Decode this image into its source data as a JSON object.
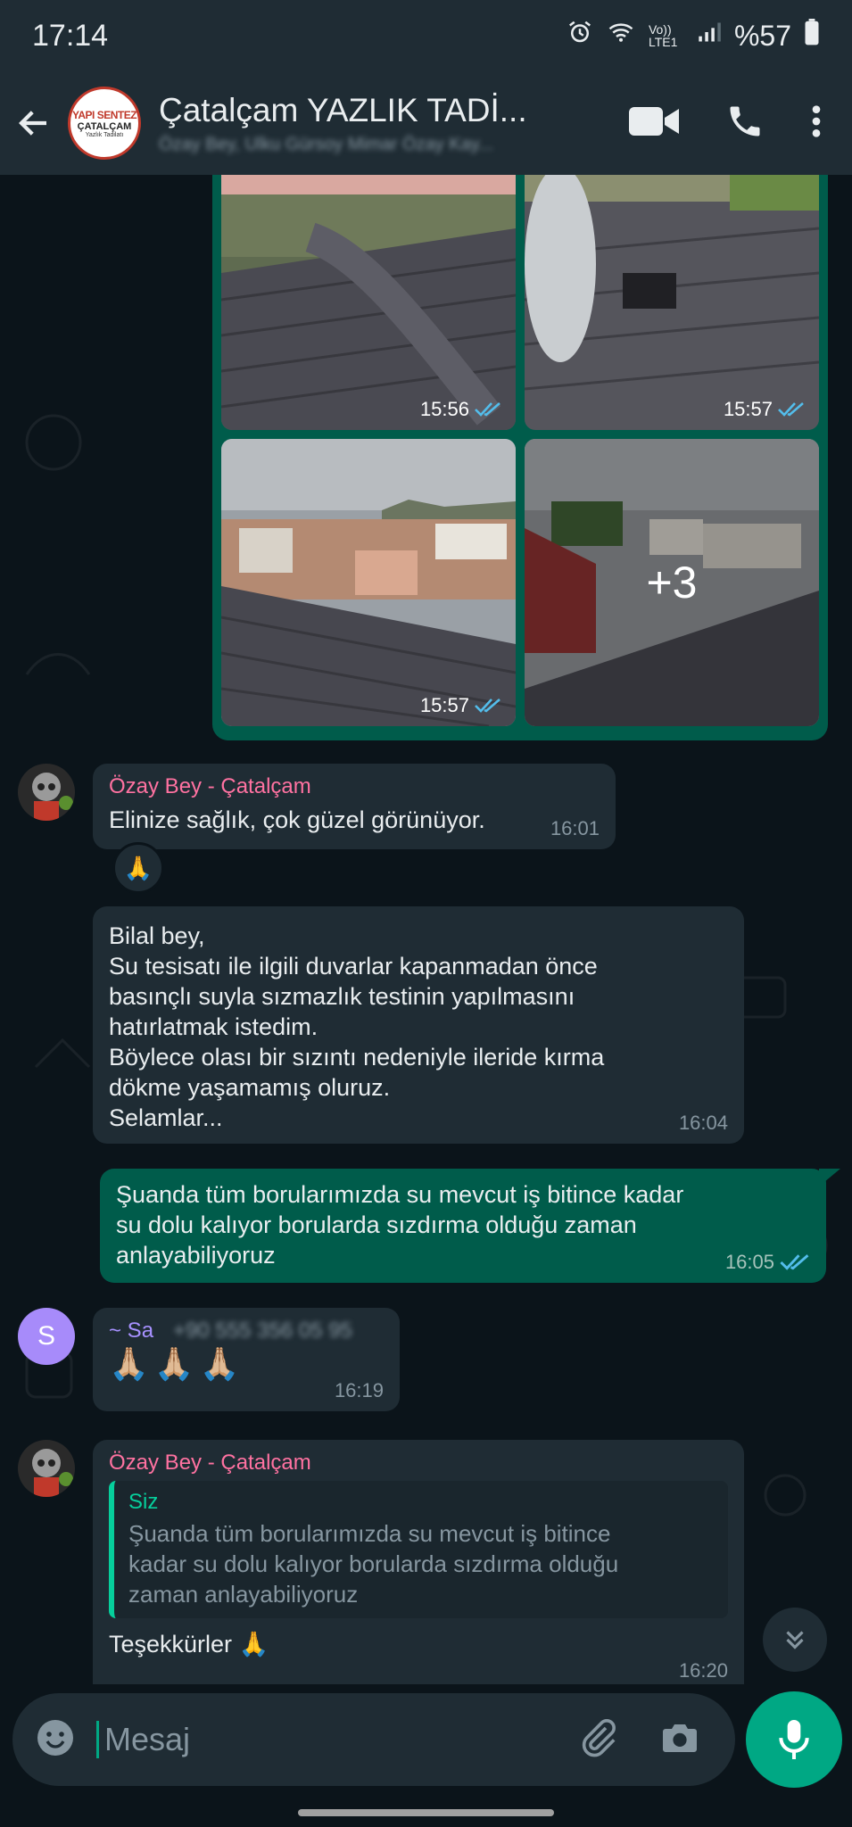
{
  "status": {
    "time": "17:14",
    "network": "Vo)) LTE1",
    "battery": "%57"
  },
  "header": {
    "title": "Çatalçam YAZLIK TADİ...",
    "subtitle": "Özay Bey, Ulku Gürsoy Mimar Özay Kay...",
    "logo": {
      "line1": "YAPI SENTEZ",
      "line2": "ÇATALÇAM",
      "line3": "Yazlık Tadilatı"
    }
  },
  "media": {
    "photos": [
      {
        "time": "15:56"
      },
      {
        "time": "15:57"
      },
      {
        "time": "15:57"
      },
      {
        "more": "+3"
      }
    ]
  },
  "messages": {
    "m1": {
      "sender": "Özay Bey - Çatalçam",
      "text": "Elinize sağlık, çok güzel görünüyor.",
      "time": "16:01",
      "reaction": "🙏"
    },
    "m2": {
      "text": "Bilal bey,\nSu tesisatı ile ilgili duvarlar kapanmadan önce\nbasınçlı suyla sızmazlık testinin yapılmasını\nhatırlatmak istedim.\nBöylece olası bir sızıntı nedeniyle ileride kırma\ndökme yaşamamış oluruz.\nSelamlar...",
      "time": "16:04"
    },
    "m3": {
      "text": "Şuanda tüm borularımızda su mevcut iş bitince kadar\nsu dolu kalıyor borularda sızdırma olduğu zaman\nanlayabiliyoruz",
      "time": "16:05"
    },
    "m4": {
      "sender": "~ Sa",
      "sender_phone": "+90 555 356 05 95",
      "avatar_letter": "S",
      "text": "🙏🏼🙏🏼🙏🏼",
      "time": "16:19"
    },
    "m5": {
      "sender": "Özay Bey - Çatalçam",
      "quote_author": "Siz",
      "quote_text": "Şuanda tüm borularımızda su mevcut iş bitince\nkadar su dolu kalıyor borularda sızdırma olduğu\nzaman anlayabiliyoruz",
      "text": "Teşekkürler 🙏",
      "time": "16:20"
    }
  },
  "input": {
    "placeholder": "Mesaj"
  },
  "colors": {
    "bg": "#0b141a",
    "bar": "#1f2c34",
    "outgoing": "#005c4b",
    "accent": "#00a884",
    "sender_pink": "#ff72a1",
    "sender_purple": "#a791ff"
  }
}
